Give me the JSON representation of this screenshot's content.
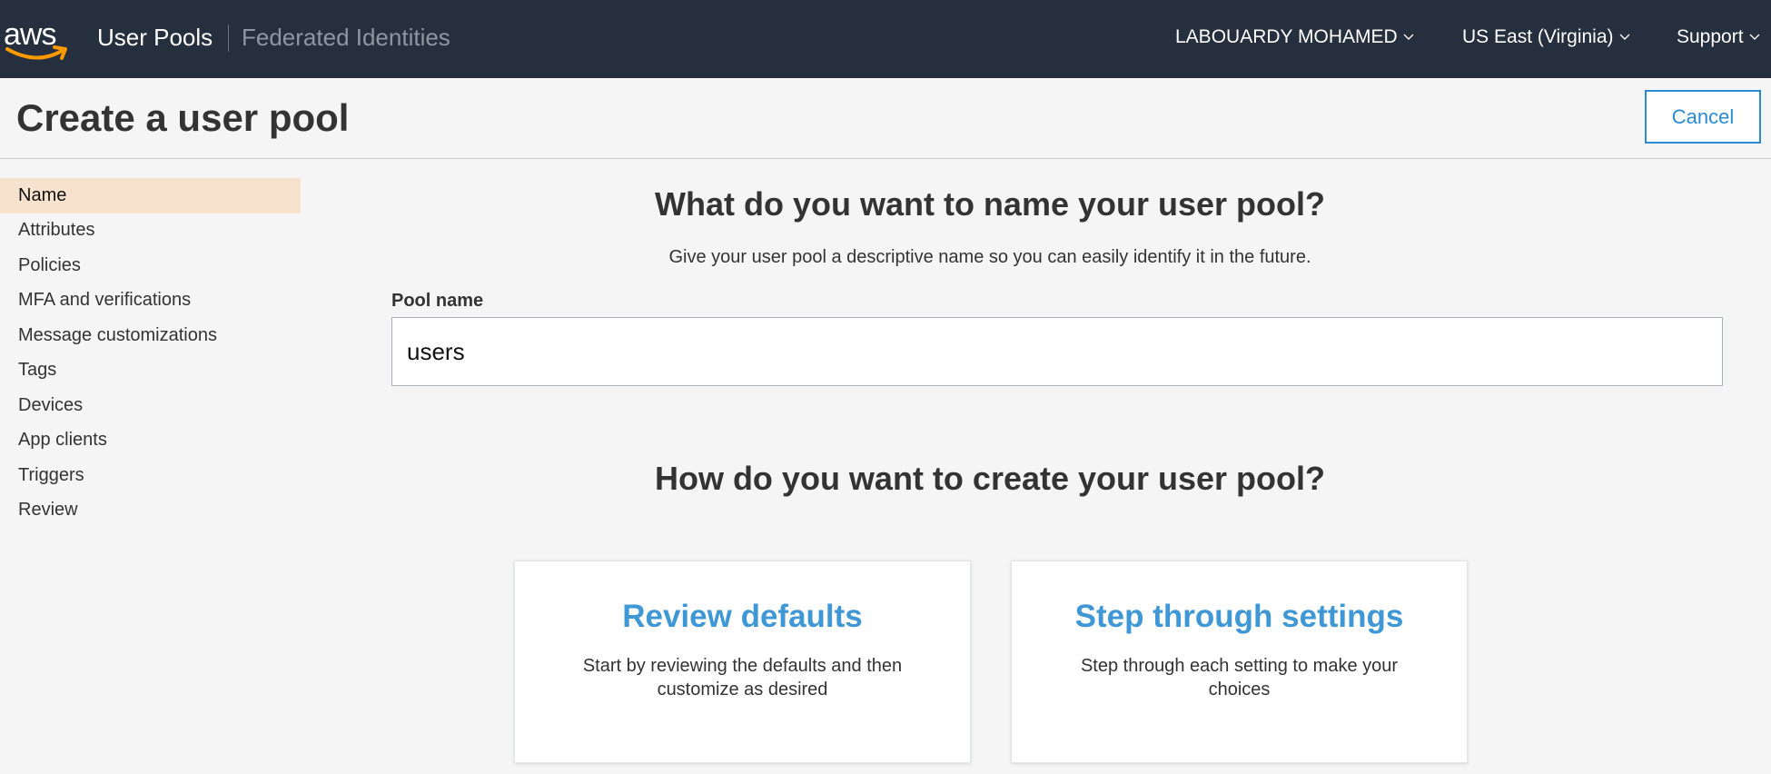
{
  "topbar": {
    "logo_text": "aws",
    "user_pools": "User Pools",
    "federated_identities": "Federated Identities",
    "account": "LABOUARDY MOHAMED",
    "region": "US East (Virginia)",
    "support": "Support"
  },
  "header": {
    "title": "Create a user pool",
    "cancel_label": "Cancel"
  },
  "sidebar": {
    "items": [
      {
        "label": "Name",
        "active": true
      },
      {
        "label": "Attributes"
      },
      {
        "label": "Policies"
      },
      {
        "label": "MFA and verifications"
      },
      {
        "label": "Message customizations"
      },
      {
        "label": "Tags"
      },
      {
        "label": "Devices"
      },
      {
        "label": "App clients"
      },
      {
        "label": "Triggers"
      },
      {
        "label": "Review"
      }
    ]
  },
  "main": {
    "name_question": "What do you want to name your user pool?",
    "name_description": "Give your user pool a descriptive name so you can easily identify it in the future.",
    "pool_name_label": "Pool name",
    "pool_name_value": "users",
    "create_question": "How do you want to create your user pool?",
    "options": [
      {
        "title": "Review defaults",
        "description": "Start by reviewing the defaults and then customize as desired"
      },
      {
        "title": "Step through settings",
        "description": "Step through each setting to make your choices"
      }
    ]
  },
  "colors": {
    "topbar": "#252f3e",
    "accent": "#2a8ad4",
    "card_title": "#3f97d6",
    "active_nav": "#f7e2cd",
    "aws_orange": "#ff9900"
  }
}
